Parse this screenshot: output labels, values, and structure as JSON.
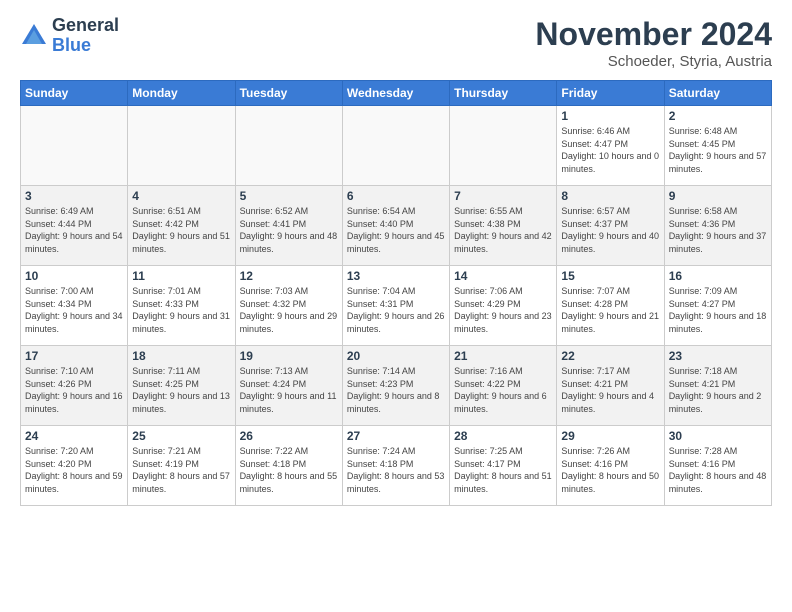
{
  "header": {
    "logo_general": "General",
    "logo_blue": "Blue",
    "month_title": "November 2024",
    "location": "Schoeder, Styria, Austria"
  },
  "weekdays": [
    "Sunday",
    "Monday",
    "Tuesday",
    "Wednesday",
    "Thursday",
    "Friday",
    "Saturday"
  ],
  "weeks": [
    [
      {
        "day": "",
        "info": ""
      },
      {
        "day": "",
        "info": ""
      },
      {
        "day": "",
        "info": ""
      },
      {
        "day": "",
        "info": ""
      },
      {
        "day": "",
        "info": ""
      },
      {
        "day": "1",
        "info": "Sunrise: 6:46 AM\nSunset: 4:47 PM\nDaylight: 10 hours\nand 0 minutes."
      },
      {
        "day": "2",
        "info": "Sunrise: 6:48 AM\nSunset: 4:45 PM\nDaylight: 9 hours\nand 57 minutes."
      }
    ],
    [
      {
        "day": "3",
        "info": "Sunrise: 6:49 AM\nSunset: 4:44 PM\nDaylight: 9 hours\nand 54 minutes."
      },
      {
        "day": "4",
        "info": "Sunrise: 6:51 AM\nSunset: 4:42 PM\nDaylight: 9 hours\nand 51 minutes."
      },
      {
        "day": "5",
        "info": "Sunrise: 6:52 AM\nSunset: 4:41 PM\nDaylight: 9 hours\nand 48 minutes."
      },
      {
        "day": "6",
        "info": "Sunrise: 6:54 AM\nSunset: 4:40 PM\nDaylight: 9 hours\nand 45 minutes."
      },
      {
        "day": "7",
        "info": "Sunrise: 6:55 AM\nSunset: 4:38 PM\nDaylight: 9 hours\nand 42 minutes."
      },
      {
        "day": "8",
        "info": "Sunrise: 6:57 AM\nSunset: 4:37 PM\nDaylight: 9 hours\nand 40 minutes."
      },
      {
        "day": "9",
        "info": "Sunrise: 6:58 AM\nSunset: 4:36 PM\nDaylight: 9 hours\nand 37 minutes."
      }
    ],
    [
      {
        "day": "10",
        "info": "Sunrise: 7:00 AM\nSunset: 4:34 PM\nDaylight: 9 hours\nand 34 minutes."
      },
      {
        "day": "11",
        "info": "Sunrise: 7:01 AM\nSunset: 4:33 PM\nDaylight: 9 hours\nand 31 minutes."
      },
      {
        "day": "12",
        "info": "Sunrise: 7:03 AM\nSunset: 4:32 PM\nDaylight: 9 hours\nand 29 minutes."
      },
      {
        "day": "13",
        "info": "Sunrise: 7:04 AM\nSunset: 4:31 PM\nDaylight: 9 hours\nand 26 minutes."
      },
      {
        "day": "14",
        "info": "Sunrise: 7:06 AM\nSunset: 4:29 PM\nDaylight: 9 hours\nand 23 minutes."
      },
      {
        "day": "15",
        "info": "Sunrise: 7:07 AM\nSunset: 4:28 PM\nDaylight: 9 hours\nand 21 minutes."
      },
      {
        "day": "16",
        "info": "Sunrise: 7:09 AM\nSunset: 4:27 PM\nDaylight: 9 hours\nand 18 minutes."
      }
    ],
    [
      {
        "day": "17",
        "info": "Sunrise: 7:10 AM\nSunset: 4:26 PM\nDaylight: 9 hours\nand 16 minutes."
      },
      {
        "day": "18",
        "info": "Sunrise: 7:11 AM\nSunset: 4:25 PM\nDaylight: 9 hours\nand 13 minutes."
      },
      {
        "day": "19",
        "info": "Sunrise: 7:13 AM\nSunset: 4:24 PM\nDaylight: 9 hours\nand 11 minutes."
      },
      {
        "day": "20",
        "info": "Sunrise: 7:14 AM\nSunset: 4:23 PM\nDaylight: 9 hours\nand 8 minutes."
      },
      {
        "day": "21",
        "info": "Sunrise: 7:16 AM\nSunset: 4:22 PM\nDaylight: 9 hours\nand 6 minutes."
      },
      {
        "day": "22",
        "info": "Sunrise: 7:17 AM\nSunset: 4:21 PM\nDaylight: 9 hours\nand 4 minutes."
      },
      {
        "day": "23",
        "info": "Sunrise: 7:18 AM\nSunset: 4:21 PM\nDaylight: 9 hours\nand 2 minutes."
      }
    ],
    [
      {
        "day": "24",
        "info": "Sunrise: 7:20 AM\nSunset: 4:20 PM\nDaylight: 8 hours\nand 59 minutes."
      },
      {
        "day": "25",
        "info": "Sunrise: 7:21 AM\nSunset: 4:19 PM\nDaylight: 8 hours\nand 57 minutes."
      },
      {
        "day": "26",
        "info": "Sunrise: 7:22 AM\nSunset: 4:18 PM\nDaylight: 8 hours\nand 55 minutes."
      },
      {
        "day": "27",
        "info": "Sunrise: 7:24 AM\nSunset: 4:18 PM\nDaylight: 8 hours\nand 53 minutes."
      },
      {
        "day": "28",
        "info": "Sunrise: 7:25 AM\nSunset: 4:17 PM\nDaylight: 8 hours\nand 51 minutes."
      },
      {
        "day": "29",
        "info": "Sunrise: 7:26 AM\nSunset: 4:16 PM\nDaylight: 8 hours\nand 50 minutes."
      },
      {
        "day": "30",
        "info": "Sunrise: 7:28 AM\nSunset: 4:16 PM\nDaylight: 8 hours\nand 48 minutes."
      }
    ]
  ]
}
